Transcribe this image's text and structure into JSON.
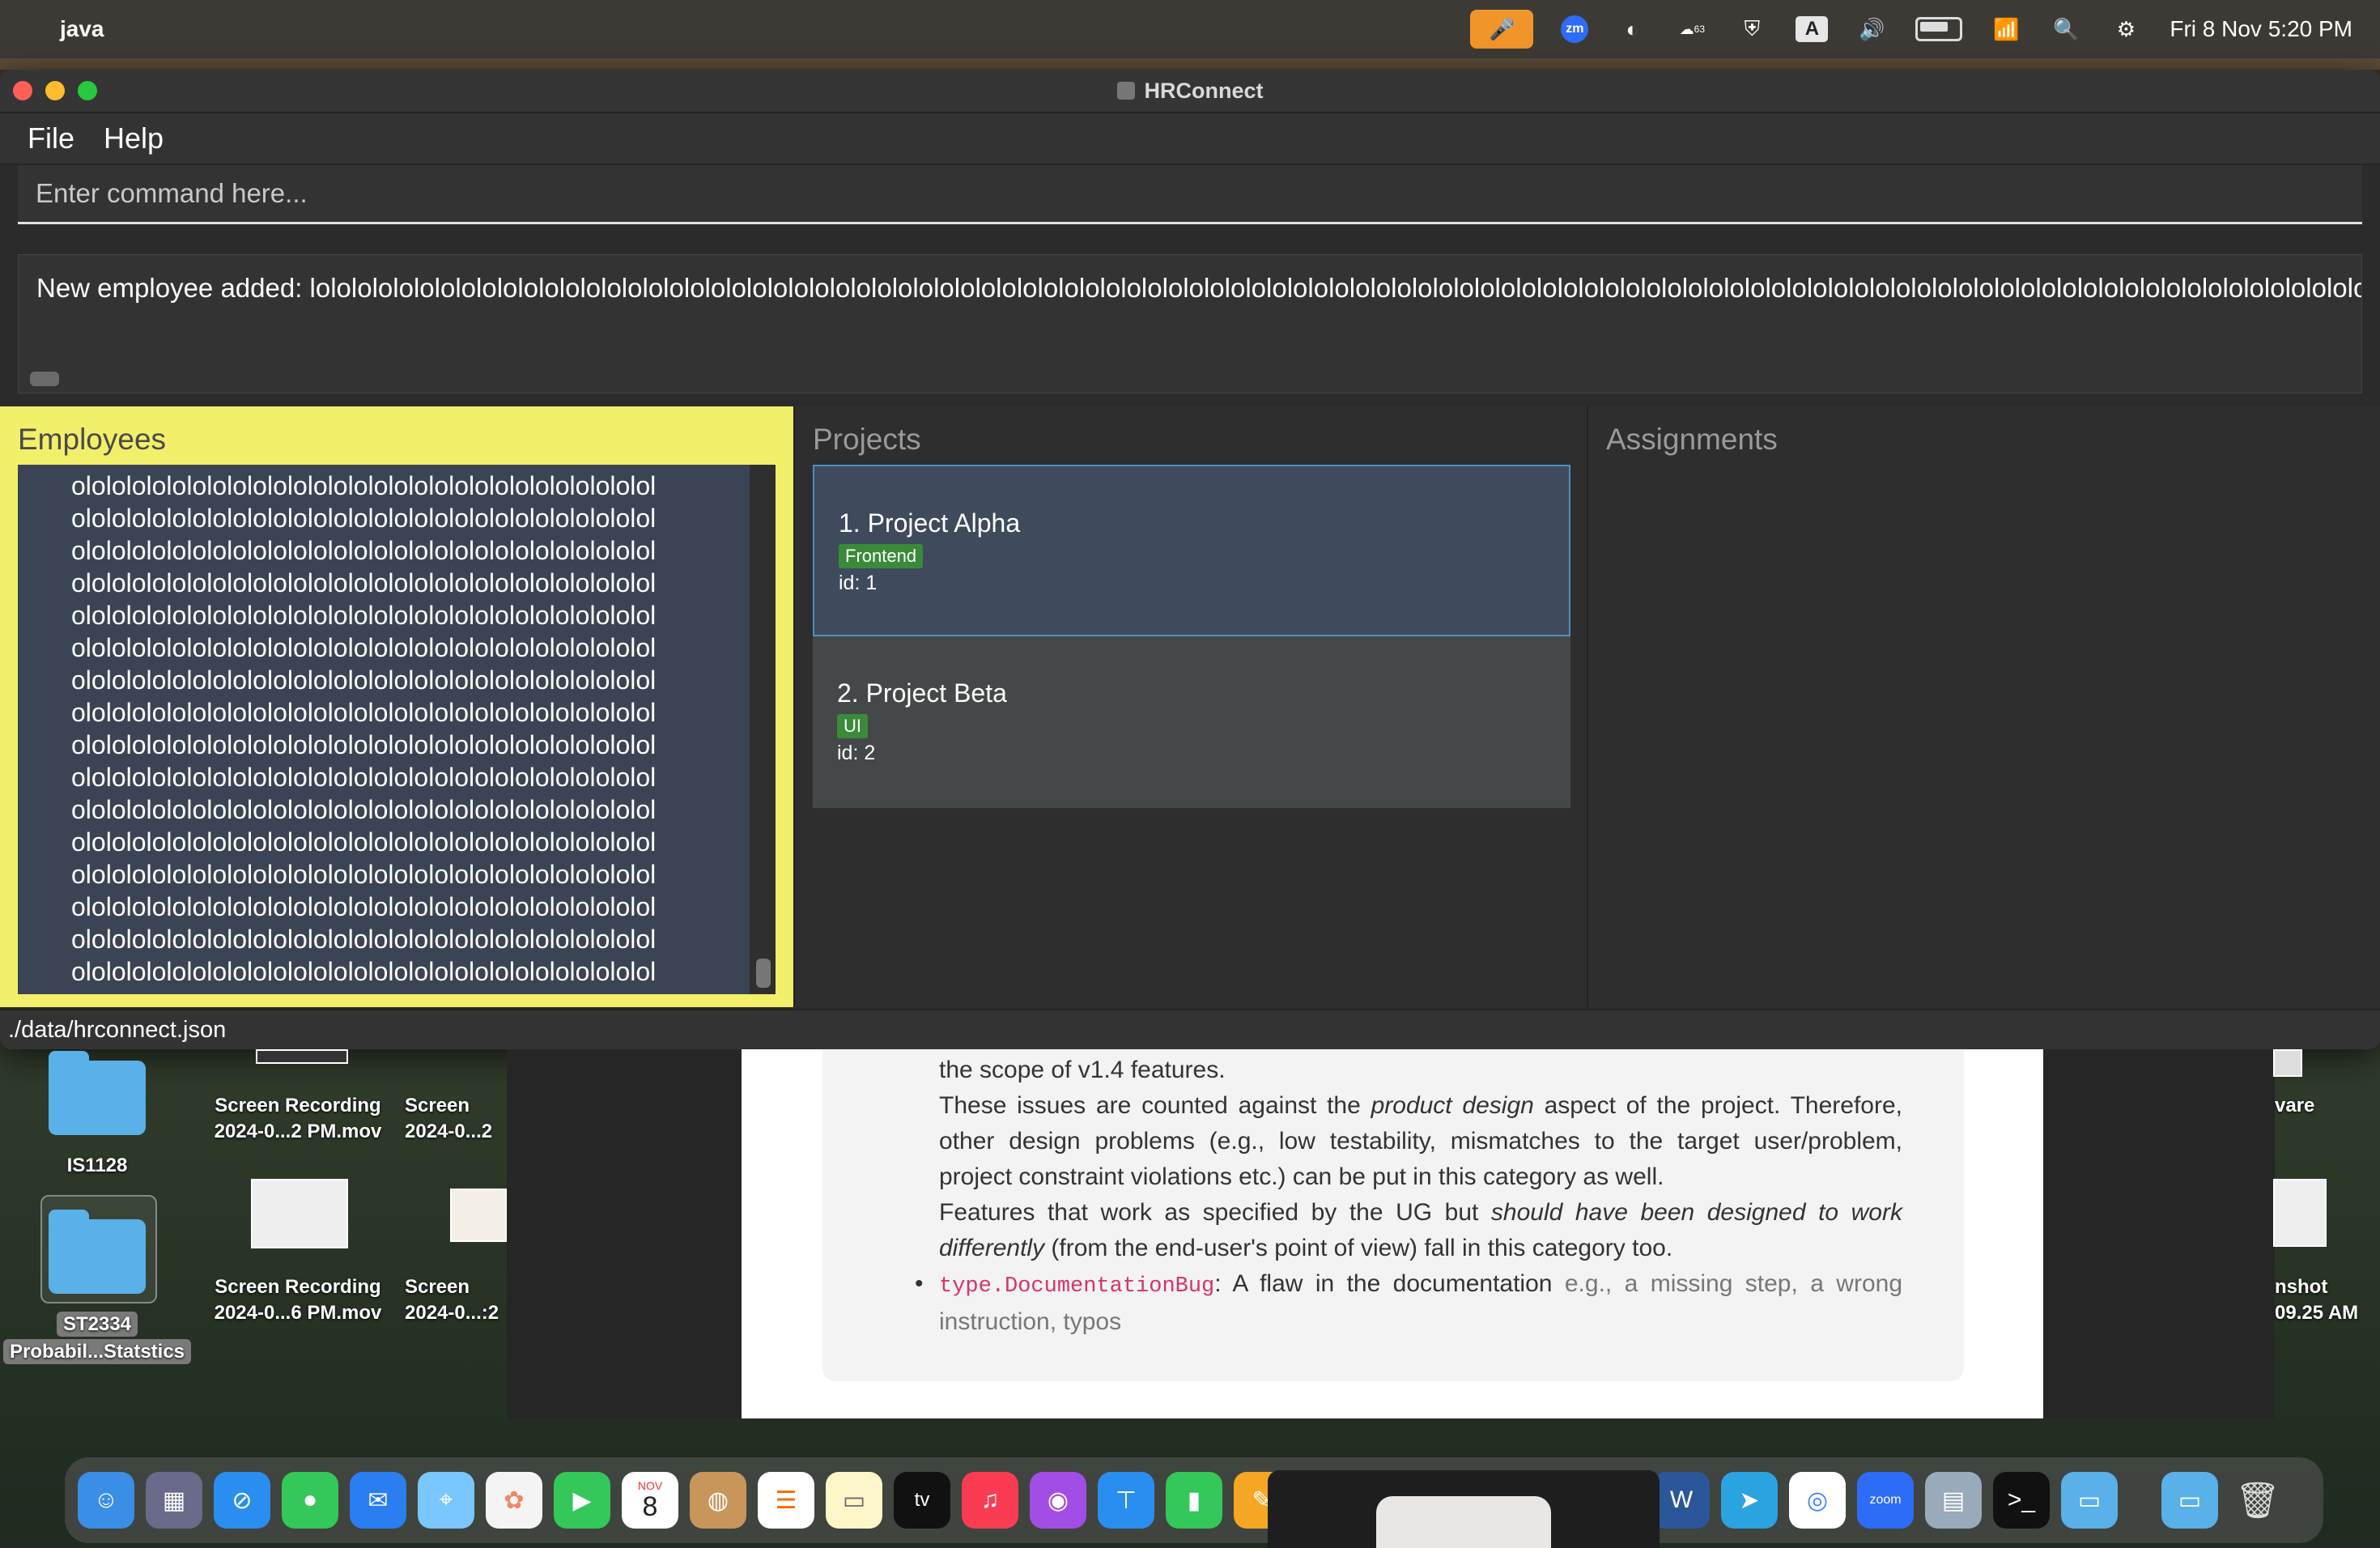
{
  "menubar": {
    "app_name": "java",
    "datetime": "Fri 8 Nov  5:20 PM",
    "icons": [
      "apple-icon",
      "microphone-icon",
      "zoom-icon",
      "sync-icon",
      "notification-badge-icon",
      "shield-icon",
      "input-source-icon",
      "volume-icon",
      "battery-icon",
      "wifi-icon",
      "search-icon",
      "control-center-icon"
    ],
    "badge_count": "63",
    "input_source": "A"
  },
  "window": {
    "title": "HRConnect",
    "menus": [
      "File",
      "Help"
    ],
    "command_placeholder": "Enter command here...",
    "result_text": "New employee added: lolololololololololololololololololololololololololololololololololololololololololololololololololololololololololololololololololololololololololololololololololololololololololololololololololololololololololololololololololololololololololololololo",
    "panels": {
      "employees_label": "Employees",
      "projects_label": "Projects",
      "assignments_label": "Assignments"
    },
    "employee_lines": [
      "ololololololololololololololololololololololololololololol",
      "ololololololololololololololololololololololololololololol",
      "ololololololololololololololololololololololololololololol",
      "ololololololololololololololololololololololololololololol",
      "ololololololololololololololololololololololololololololol",
      "ololololololololololololololololololololololololololololol",
      "ololololololololololololololololololololololololololololol",
      "ololololololololololololololololololololololololololololol",
      "ololololololololololololololololololololololololololololol",
      "ololololololololololololololololololololololololololololol",
      "ololololololololololololololololololololololololololololol",
      "ololololololololololololololololololololololololololololol",
      "ololololololololololololololololololololololololololololol",
      "ololololololololololololololololololololololololololololol",
      "ololololololololololololololololololololololololololololol",
      "ololololololololololololololololololololololololololololol"
    ],
    "projects": [
      {
        "name": "1. Project Alpha",
        "tag": "Frontend",
        "id": "id: 1"
      },
      {
        "name": "2. Project Beta",
        "tag": "UI",
        "id": "id: 2"
      }
    ],
    "status_path": "./data/hrconnect.json"
  },
  "desktop": {
    "items": [
      {
        "label": "IS1128"
      },
      {
        "label_line1": "ST2334",
        "label_line2": "Probabil...Statstics"
      },
      {
        "label_line1": "Screen Recording",
        "label_line2": "2024-0...2 PM.mov"
      },
      {
        "label_line1": "Screen Recording",
        "label_line2": "2024-0...6 PM.mov"
      },
      {
        "label_line1": "Screen",
        "label_line2": "2024-0...2"
      },
      {
        "label_line1": "Screen",
        "label_line2": "2024-0...:2"
      },
      {
        "label": "vare"
      },
      {
        "label_line1": "nshot",
        "label_line2": "09.25 AM"
      }
    ]
  },
  "doc": {
    "line_scope": "the scope of v1.4 features.",
    "para1_a": "These issues are counted against the ",
    "para1_em": "product design",
    "para1_b": " aspect of the project. Therefore, other design problems (e.g., low testability, mismatches to the target user/problem, project constraint violations etc.) can be put in this category as well.",
    "para2_a": "Features that work as specified by the UG but ",
    "para2_em": "should have been designed to work differently",
    "para2_b": " (from the end-user's point of view) fall in this category too.",
    "bullet_code": "type.DocumentationBug",
    "bullet_text": ": A flaw in the documentation ",
    "bullet_grey": "e.g., a missing step, a wrong instruction, typos"
  },
  "dock": {
    "calendar_month": "NOV",
    "calendar_day": "8",
    "tv_label": "tv",
    "zoom_label": "zoom"
  }
}
